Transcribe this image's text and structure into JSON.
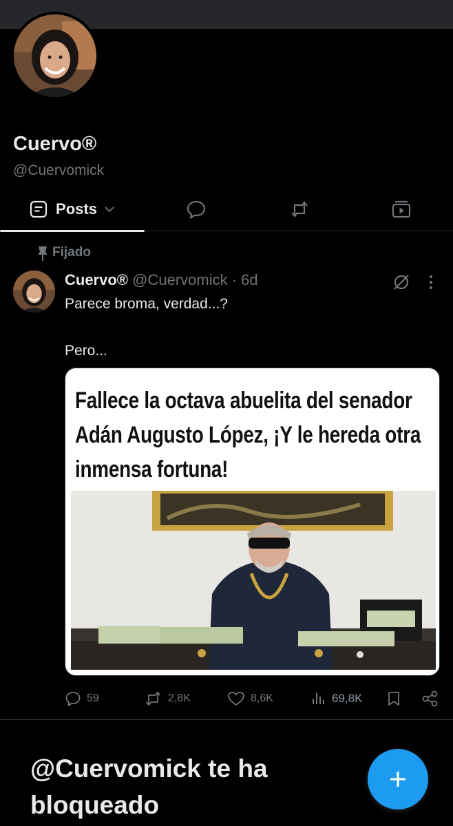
{
  "profile": {
    "display_name": "Cuervo®",
    "handle": "@Cuervomick"
  },
  "tabs": [
    {
      "label": "Posts",
      "icon": "posts-icon",
      "selected": true
    },
    {
      "label": "",
      "icon": "replies-icon",
      "selected": false
    },
    {
      "label": "",
      "icon": "repost-icon",
      "selected": false
    },
    {
      "label": "",
      "icon": "media-icon",
      "selected": false
    }
  ],
  "pinned_label": "Fijado",
  "post": {
    "author_name": "Cuervo®",
    "author_handle": "@Cuervomick",
    "separator": "·",
    "time": "6d",
    "text_line1": "Parece broma, verdad...?",
    "text_line2": "Pero...",
    "media": {
      "headline": "Fallece la octava abuelita del senador Adán Augusto López, ¡Y le hereda otra inmensa fortuna!"
    },
    "stats": {
      "replies": "59",
      "reposts": "2,8K",
      "likes": "8,6K",
      "views": "69,8K"
    }
  },
  "blocked_message": "@Cuervomick te ha bloqueado",
  "colors": {
    "background": "#000000",
    "text_primary": "#e7e9ea",
    "text_secondary": "#71767b",
    "divider": "#2f3336",
    "accent": "#1d9bf0"
  }
}
